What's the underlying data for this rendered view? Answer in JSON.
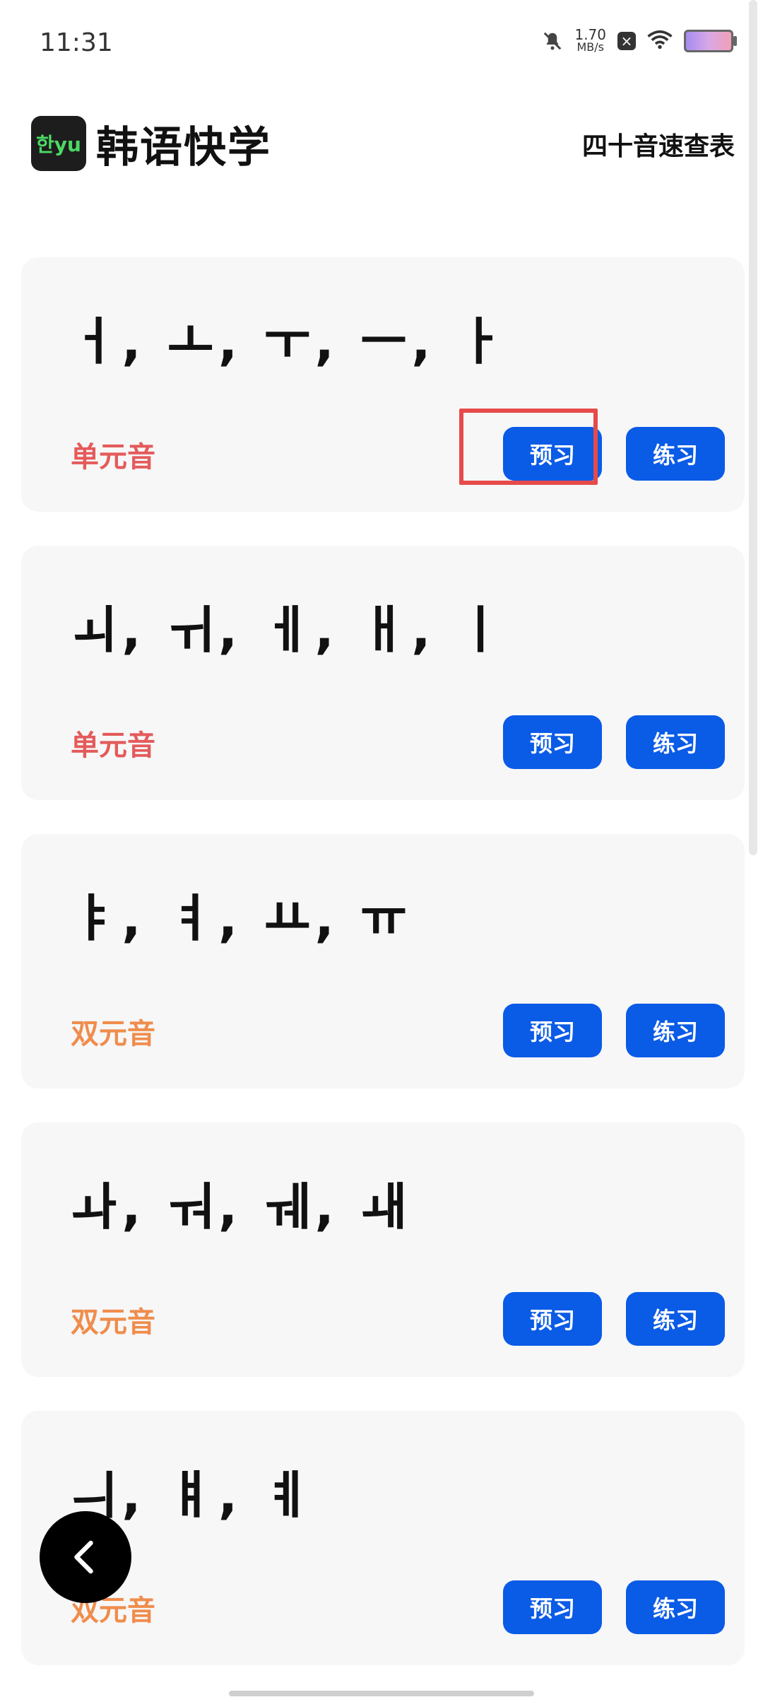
{
  "status_bar": {
    "time": "11:31",
    "net_speed": "1.70",
    "net_unit": "MB/s"
  },
  "header": {
    "logo_text": "한yu",
    "app_title": "韩语快学",
    "right_link": "四十音速查表"
  },
  "cards": [
    {
      "letters": "ㅓ, ㅗ, ㅜ, ㅡ, ㅏ",
      "category": "单元音",
      "preview_label": "预习",
      "practice_label": "练习"
    },
    {
      "letters": "ㅚ, ㅟ, ㅔ, ㅐ, ㅣ",
      "category": "单元音",
      "preview_label": "预习",
      "practice_label": "练习"
    },
    {
      "letters": "ㅑ, ㅕ, ㅛ, ㅠ",
      "category": "双元音",
      "preview_label": "预习",
      "practice_label": "练习"
    },
    {
      "letters": "ㅘ, ㅝ, ㅞ, ㅙ",
      "category": "双元音",
      "preview_label": "预习",
      "practice_label": "练习"
    },
    {
      "letters": "ㅢ, ㅒ, ㅖ",
      "category": "双元音",
      "preview_label": "预习",
      "practice_label": "练习"
    }
  ],
  "colors": {
    "accent": "#0a5be6",
    "mono_vowel": "#e45b5b",
    "di_vowel": "#ef8d4c",
    "highlight": "#e64a4a"
  },
  "icons": {
    "mute": "bell-off-icon",
    "close_box": "close-box-icon",
    "wifi": "wifi-icon",
    "battery": "battery-icon",
    "back": "chevron-left-icon"
  }
}
